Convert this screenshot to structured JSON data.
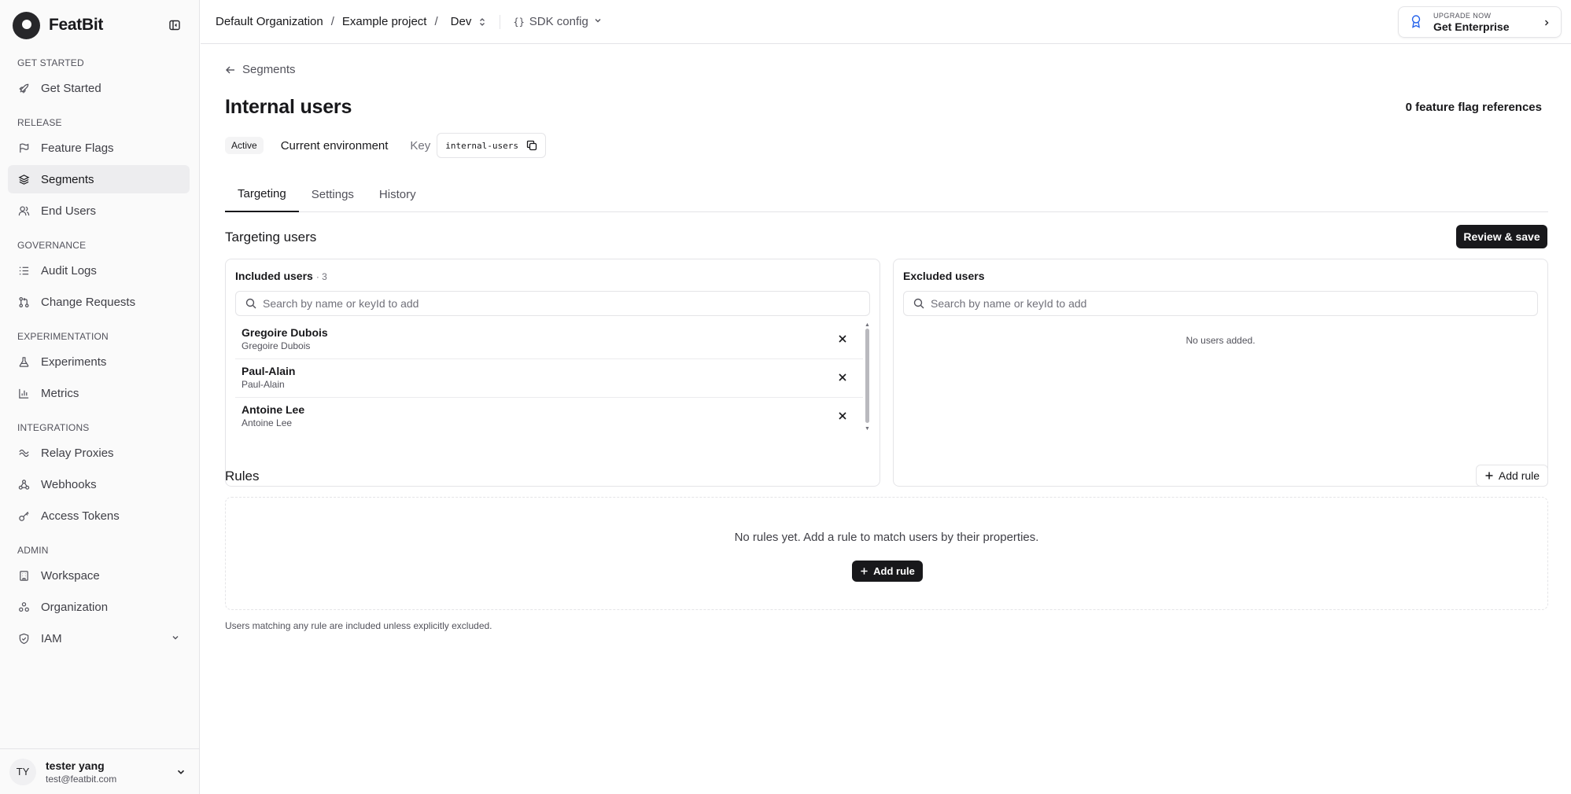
{
  "brand": {
    "name": "FeatBit"
  },
  "sidebar": {
    "sections": [
      {
        "title": "GET STARTED",
        "items": [
          {
            "label": "Get Started",
            "icon": "rocket-icon"
          }
        ]
      },
      {
        "title": "RELEASE",
        "items": [
          {
            "label": "Feature Flags",
            "icon": "flag-icon"
          },
          {
            "label": "Segments",
            "icon": "layers-icon",
            "active": true
          },
          {
            "label": "End Users",
            "icon": "users-icon"
          }
        ]
      },
      {
        "title": "GOVERNANCE",
        "items": [
          {
            "label": "Audit Logs",
            "icon": "list-icon"
          },
          {
            "label": "Change Requests",
            "icon": "git-pull-request-icon"
          }
        ]
      },
      {
        "title": "EXPERIMENTATION",
        "items": [
          {
            "label": "Experiments",
            "icon": "flask-icon"
          },
          {
            "label": "Metrics",
            "icon": "bar-chart-icon"
          }
        ]
      },
      {
        "title": "INTEGRATIONS",
        "items": [
          {
            "label": "Relay Proxies",
            "icon": "relay-icon"
          },
          {
            "label": "Webhooks",
            "icon": "webhook-icon"
          },
          {
            "label": "Access Tokens",
            "icon": "key-icon"
          }
        ]
      },
      {
        "title": "ADMIN",
        "items": [
          {
            "label": "Workspace",
            "icon": "building-icon"
          },
          {
            "label": "Organization",
            "icon": "organization-icon"
          },
          {
            "label": "IAM",
            "icon": "shield-icon",
            "expandable": true
          }
        ]
      }
    ],
    "user": {
      "initials": "TY",
      "name": "tester yang",
      "email": "test@featbit.com"
    }
  },
  "header": {
    "breadcrumbs": [
      "Default Organization",
      "Example project"
    ],
    "environment": "Dev",
    "sdk_config_label": "SDK config",
    "upgrade": {
      "small": "UPGRADE NOW",
      "big": "Get Enterprise"
    }
  },
  "page": {
    "back_label": "Segments",
    "title": "Internal users",
    "references": "0 feature flag references",
    "status": "Active",
    "environment_scope": "Current environment",
    "key_label": "Key",
    "key_value": "internal-users",
    "tabs": [
      "Targeting",
      "Settings",
      "History"
    ],
    "active_tab": "Targeting"
  },
  "targeting": {
    "title": "Targeting users",
    "save_button": "Review & save",
    "included": {
      "title": "Included users",
      "count": "· 3",
      "search_placeholder": "Search by name or keyId to add",
      "users": [
        {
          "name": "Gregoire Dubois",
          "key": "Gregoire Dubois"
        },
        {
          "name": "Paul-Alain",
          "key": "Paul-Alain"
        },
        {
          "name": "Antoine Lee",
          "key": "Antoine Lee"
        }
      ]
    },
    "excluded": {
      "title": "Excluded users",
      "search_placeholder": "Search by name or keyId to add",
      "empty": "No users added."
    }
  },
  "rules": {
    "title": "Rules",
    "add_button": "Add rule",
    "empty_text": "No rules yet. Add a rule to match users by their properties.",
    "add_button_center": "Add rule",
    "footnote": "Users matching any rule are included unless explicitly excluded."
  },
  "colors": {
    "primary": "#18181b",
    "border": "#e4e4e7",
    "muted": "#71717a",
    "sidebar_bg": "#fafafa",
    "active_bg": "#ededef"
  }
}
